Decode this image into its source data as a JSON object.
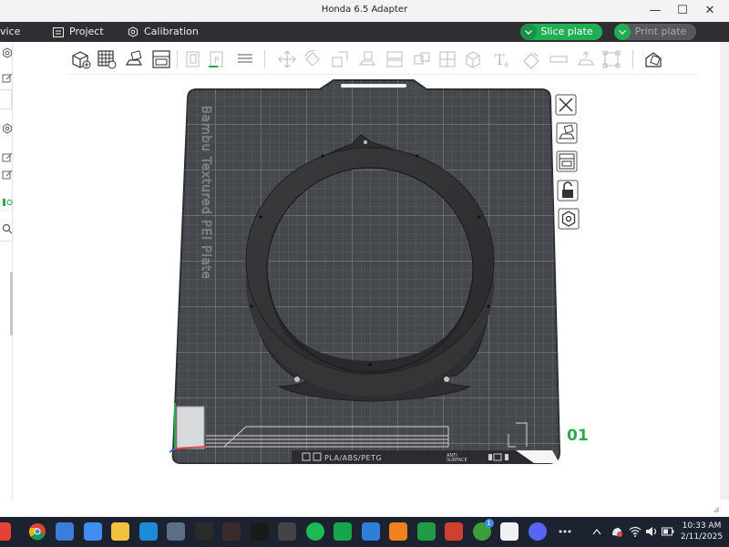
{
  "window": {
    "title": "Honda 6.5 Adapter",
    "minimize": "—",
    "maximize": "☐",
    "close": "✕"
  },
  "menu": {
    "device_partial": "vice",
    "project": "Project",
    "calibration": "Calibration",
    "slice_plate": "Slice plate",
    "print_plate": "Print plate"
  },
  "toolbar": {
    "icons": [
      "add-object-icon",
      "grid-arrange-icon",
      "auto-orient-icon",
      "plate-layout-icon",
      "plate-duplicate-icon",
      "plate-copy-icon",
      "plate-settings-icon",
      "move-icon",
      "rotate-icon",
      "scale-icon",
      "lay-on-face-icon",
      "cut-icon",
      "split-objects-icon",
      "split-parts-icon",
      "variable-layer-icon",
      "support-paint-icon",
      "measure-icon",
      "text-icon",
      "seam-paint-icon",
      "mesh-boolean-icon",
      "assembly-icon",
      "brim-ears-icon",
      "fit-view-icon"
    ]
  },
  "plate": {
    "bed_label": "Bambu Textured PEI Plate",
    "filament_label": "PLA/ABS/PETG",
    "surface_label_1": "ANTI",
    "surface_label_2": "SURFACE",
    "number": "01"
  },
  "side_buttons": [
    "close-plate-icon",
    "auto-orient-plate-icon",
    "arrange-plate-icon",
    "lock-plate-icon",
    "plate-settings-icon"
  ],
  "taskbar": {
    "apps": [
      {
        "name": "app-red-icon",
        "color": "#e34234"
      },
      {
        "name": "chrome-icon",
        "color": "#f4b400"
      },
      {
        "name": "edge-app-icon",
        "color": "#3b7dd8"
      },
      {
        "name": "notepad-icon",
        "color": "#3f8ef0"
      },
      {
        "name": "file-explorer-icon",
        "color": "#f2c13d"
      },
      {
        "name": "bambu-app-icon",
        "color": "#1b8bd6"
      },
      {
        "name": "cricut-icon",
        "color": "#5a6f84"
      },
      {
        "name": "dm-app-icon",
        "color": "#2a2a2a"
      },
      {
        "name": "dots-app-icon",
        "color": "#3a2a2a"
      },
      {
        "name": "tidal-icon",
        "color": "#1a1a1a"
      },
      {
        "name": "phone-link-icon",
        "color": "#444444"
      },
      {
        "name": "spotify-icon",
        "color": "#1db954"
      },
      {
        "name": "bambu-studio-icon",
        "color": "#19a64a"
      },
      {
        "name": "c-app-icon",
        "color": "#2f7fd8"
      },
      {
        "name": "f-app-icon",
        "color": "#f2811d"
      },
      {
        "name": "excel-icon",
        "color": "#1f9a45"
      },
      {
        "name": "grubhub-icon",
        "color": "#d0402f"
      },
      {
        "name": "xbox-icon",
        "color": "#3c9d3c"
      },
      {
        "name": "store-icon",
        "color": "#f1f1f1"
      },
      {
        "name": "discord-icon",
        "color": "#5865f2"
      },
      {
        "name": "more-apps-icon",
        "color": "#1d2230"
      }
    ],
    "time": "10:33 AM",
    "date": "2/11/2025",
    "xbox_badge": "1"
  }
}
